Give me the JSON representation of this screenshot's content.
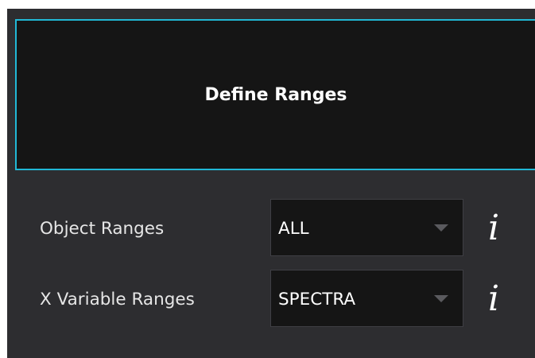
{
  "panel": {
    "title": "Define Ranges"
  },
  "ranges": [
    {
      "label": "Object Ranges",
      "selected": "ALL",
      "info_icon": "i"
    },
    {
      "label": "X Variable Ranges",
      "selected": "SPECTRA",
      "info_icon": "i"
    }
  ],
  "colors": {
    "panel_background": "#2d2d30",
    "button_background": "#151515",
    "button_border": "#21b8d6",
    "text": "#e6e6e6",
    "dropdown_arrow": "#5a5a5e"
  },
  "icons": {
    "dropdown": "chevron-down-icon",
    "info": "info-icon"
  }
}
